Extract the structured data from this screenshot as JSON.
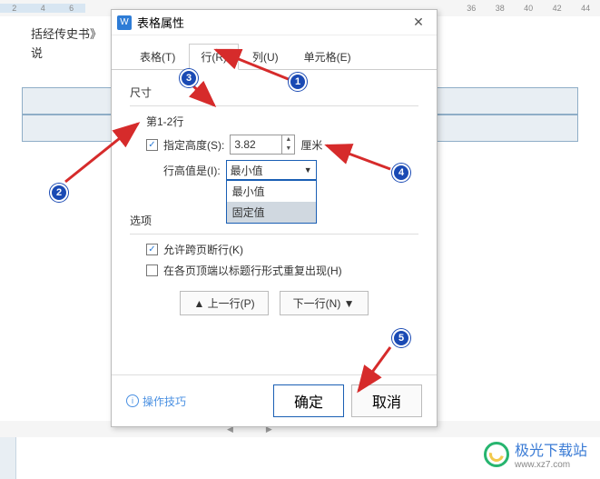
{
  "ruler": {
    "marks": [
      "2",
      "4",
      "6",
      "",
      "",
      "",
      "",
      "",
      "",
      "",
      "",
      "",
      "",
      "",
      "",
      "",
      "",
      "36",
      "38",
      "40",
      "42",
      "44"
    ],
    "selected_idx": [
      0,
      1,
      2
    ]
  },
  "doc": {
    "line1": "括经传史书》",
    "line2": "说"
  },
  "dialog": {
    "title": "表格属性",
    "close_icon": "close-icon",
    "tabs": [
      {
        "label": "表格(T)",
        "active": false
      },
      {
        "label": "行(R)",
        "active": true
      },
      {
        "label": "列(U)",
        "active": false
      },
      {
        "label": "单元格(E)",
        "active": false
      }
    ],
    "size_group": "尺寸",
    "row_range": "第1-2行",
    "specify_height_checked": true,
    "specify_height_label": "指定高度(S):",
    "height_value": "3.82",
    "height_unit": "厘米",
    "row_height_is_label": "行高值是(I):",
    "row_height_is_value": "最小值",
    "row_height_options": [
      "最小值",
      "固定值"
    ],
    "dropdown_selected_idx": 1,
    "options_group": "选项",
    "allow_break_checked": true,
    "allow_break_label": "允许跨页断行(K)",
    "repeat_header_checked": false,
    "repeat_header_label": "在各页顶端以标题行形式重复出现(H)",
    "prev_row_btn": "▲ 上一行(P)",
    "next_row_btn": "下一行(N) ▼",
    "tip_label": "操作技巧",
    "ok_label": "确定",
    "cancel_label": "取消"
  },
  "markers": {
    "m1": "1",
    "m2": "2",
    "m3": "3",
    "m4": "4",
    "m5": "5"
  },
  "watermark": {
    "name": "极光下载站",
    "url": "www.xz7.com"
  },
  "chart_data": {
    "type": "table",
    "note": "not a chart"
  }
}
